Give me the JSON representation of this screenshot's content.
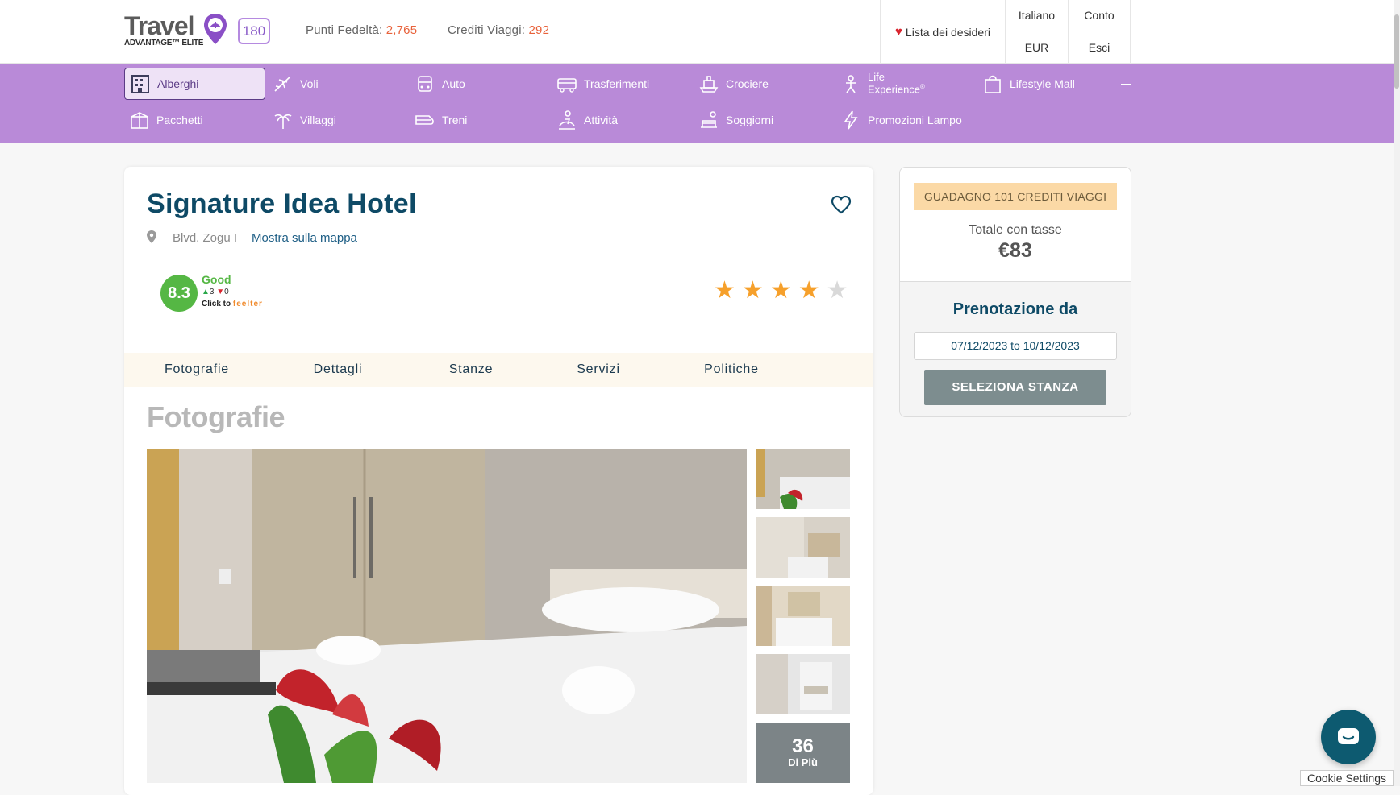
{
  "header": {
    "logo_text": "Travel",
    "logo_sub": "ADVANTAGE™ ELITE",
    "tier_badge": "180",
    "loyalty_label": "Punti Fedeltà:",
    "loyalty_value": "2,765",
    "credits_label": "Crediti Viaggi:",
    "credits_value": "292",
    "wishlist": "Lista dei desideri",
    "language": "Italiano",
    "account": "Conto",
    "currency": "EUR",
    "logout": "Esci"
  },
  "nav": {
    "items": [
      {
        "label": "Alberghi",
        "icon": "hotel-icon"
      },
      {
        "label": "Voli",
        "icon": "plane-icon"
      },
      {
        "label": "Auto",
        "icon": "car-icon"
      },
      {
        "label": "Trasferimenti",
        "icon": "bus-icon"
      },
      {
        "label": "Crociere",
        "icon": "cruise-icon"
      },
      {
        "label": "Life",
        "label2": "Experience",
        "reg": "®",
        "icon": "life-experience-icon"
      },
      {
        "label": "Lifestyle Mall",
        "icon": "shopping-bag-icon"
      },
      {
        "label": "Pacchetti",
        "icon": "package-icon"
      },
      {
        "label": "Villaggi",
        "icon": "palm-icon"
      },
      {
        "label": "Treni",
        "icon": "train-icon"
      },
      {
        "label": "Attività",
        "icon": "activity-icon"
      },
      {
        "label": "Soggiorni",
        "icon": "stay-icon"
      },
      {
        "label": "Promozioni Lampo",
        "icon": "lightning-icon"
      }
    ]
  },
  "hotel": {
    "name": "Signature Idea Hotel",
    "address": "Blvd. Zogu I",
    "map_link": "Mostra sulla mappa",
    "score": "8.3",
    "score_label": "Good",
    "votes_up": "3",
    "votes_down": "0",
    "feelter_prefix": "Click to",
    "feelter_brand": "feelter",
    "stars": 4,
    "stars_max": 5
  },
  "tabs": [
    "Fotografie",
    "Dettagli",
    "Stanze",
    "Servizi",
    "Politiche"
  ],
  "photos": {
    "section_title": "Fotografie",
    "more_count": "36",
    "more_label": "Di Più"
  },
  "booking": {
    "earn": "GUADAGNO 101 CREDITI VIAGGI",
    "total_label": "Totale con tasse",
    "total_price": "€83",
    "title": "Prenotazione da",
    "dates": "07/12/2023 to 10/12/2023",
    "select_button": "SELEZIONA STANZA"
  },
  "cookie": "Cookie Settings"
}
